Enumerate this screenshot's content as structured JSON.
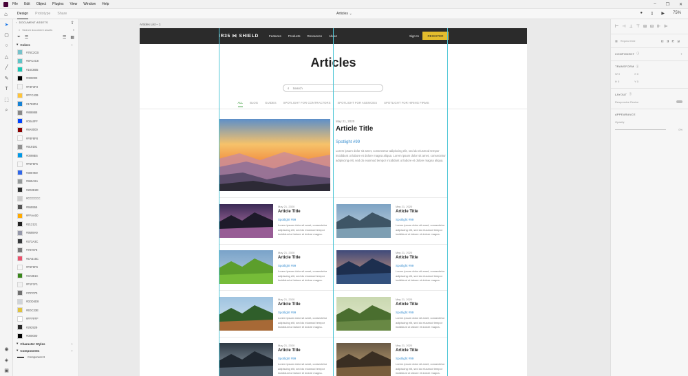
{
  "menu": [
    "File",
    "Edit",
    "Object",
    "Plugins",
    "View",
    "Window",
    "Help"
  ],
  "window_controls": [
    "–",
    "❐",
    "✕"
  ],
  "modes": [
    "Design",
    "Prototype",
    "Share"
  ],
  "doc_title": "Articles ⌄",
  "zoom": "75%",
  "assets": {
    "header": "DOCUMENT ASSETS",
    "search_placeholder": "Search document assets",
    "colors_label": "Colors",
    "colors": [
      {
        "hex": "#76C2CB"
      },
      {
        "hex": "#5FC4C8"
      },
      {
        "hex": "#16C8B5"
      },
      {
        "hex": "#000000"
      },
      {
        "hex": "#F3F3F3"
      },
      {
        "hex": "#FFC439"
      },
      {
        "hex": "#1782D4"
      },
      {
        "hex": "#888888"
      },
      {
        "hex": "#0044FF"
      },
      {
        "hex": "#8A0000"
      },
      {
        "hex": "#F8F8F8"
      },
      {
        "hex": "#919191"
      },
      {
        "hex": "#0098E6"
      },
      {
        "hex": "#F5F5F5"
      },
      {
        "hex": "#3067E9"
      },
      {
        "hex": "#969A9A"
      },
      {
        "hex": "#2D2E2E"
      },
      {
        "hex": "#CCCCCC"
      },
      {
        "hex": "#555555"
      },
      {
        "hex": "#FFAA00"
      },
      {
        "hex": "#212121"
      },
      {
        "hex": "#9598A9"
      },
      {
        "hex": "#373A3C"
      },
      {
        "hex": "#787878"
      },
      {
        "hex": "#EA516C"
      },
      {
        "hex": "#F6F6F6"
      },
      {
        "hex": "#3A861C"
      },
      {
        "hex": "#F1F1F1"
      },
      {
        "hex": "#707070"
      },
      {
        "hex": "#D0D4D8"
      },
      {
        "hex": "#E0C33E"
      },
      {
        "hex": "#FFFFFF"
      },
      {
        "hex": "#292929"
      },
      {
        "hex": "#000000"
      }
    ],
    "char_styles_label": "Character Styles",
    "components_label": "Components",
    "component_item": "Component 3"
  },
  "artboard_label": "Articles List – 1",
  "site": {
    "brand": "IR35 ⋈ SHIELD",
    "nav": [
      "Features",
      "Products",
      "Resources",
      "About"
    ],
    "signin": "Sign In",
    "register": "REGISTER",
    "heading": "Articles",
    "search_placeholder": "Search",
    "tabs": [
      "ALL",
      "BLOG",
      "GUIDES",
      "SPOTLIGHT FOR CONTRACTORS",
      "SPOTLIGHT FOR AGENCIES",
      "SPOTLIGHT FOR HIRING FIRMS"
    ],
    "featured": {
      "date": "May 21, 2020",
      "title": "Article Title",
      "spotlight": "Spotlight #99",
      "body": "Lorem ipsum dolor sit amet, consectetur adipiscing elit, sed do eiusmod tempor incididunt ut labore et dolore magna aliqua. Lorem ipsum dolor sit amet, consectetur adipiscing elit, sed do eiusmod tempor incididunt ut labore et dolore magna aliqua."
    },
    "cards": [
      {
        "date": "May 21, 2020",
        "title": "Article Title",
        "spotlight": "Spotlight #99",
        "body": "Lorem ipsum dolor sit amet, consectetur adipiscing elit, sed do eiusmod tempor incididunt ut labore et dolore magna."
      },
      {
        "date": "May 21, 2020",
        "title": "Article Title",
        "spotlight": "Spotlight #99",
        "body": "Lorem ipsum dolor sit amet, consectetur adipiscing elit, sed do eiusmod tempor incididunt ut labore et dolore magna."
      },
      {
        "date": "May 21, 2020",
        "title": "Article Title",
        "spotlight": "Spotlight #99",
        "body": "Lorem ipsum dolor sit amet, consectetur adipiscing elit, sed do eiusmod tempor incididunt ut labore et dolore magna."
      },
      {
        "date": "May 21, 2020",
        "title": "Article Title",
        "spotlight": "Spotlight #99",
        "body": "Lorem ipsum dolor sit amet, consectetur adipiscing elit, sed do eiusmod tempor incididunt ut labore et dolore magna."
      },
      {
        "date": "May 21, 2020",
        "title": "Article Title",
        "spotlight": "Spotlight #99",
        "body": "Lorem ipsum dolor sit amet, consectetur adipiscing elit, sed do eiusmod tempor incididunt ut labore et dolore magna."
      },
      {
        "date": "May 21, 2020",
        "title": "Article Title",
        "spotlight": "Spotlight #99",
        "body": "Lorem ipsum dolor sit amet, consectetur adipiscing elit, sed do eiusmod tempor incididunt ut labore et dolore magna."
      },
      {
        "date": "May 21, 2020",
        "title": "Article Title",
        "spotlight": "Spotlight #99",
        "body": "Lorem ipsum dolor sit amet, consectetur adipiscing elit, sed do eiusmod tempor incididunt ut labore et dolore magna."
      },
      {
        "date": "May 21, 2020",
        "title": "Article Title",
        "spotlight": "Spotlight #99",
        "body": "Lorem ipsum dolor sit amet, consectetur adipiscing elit, sed do eiusmod tempor incididunt ut labore et dolore magna."
      }
    ]
  },
  "right_panel": {
    "repeat_grid": "Repeat Grid",
    "component": "COMPONENT",
    "transform": "TRANSFORM",
    "w": "W  0",
    "x": "X  0",
    "h": "H  0",
    "y": "Y  0",
    "layout": "LAYOUT",
    "responsive_resize": "Responsive Resize",
    "appearance": "APPEARANCE",
    "opacity": "Opacity",
    "opacity_value": "0%"
  }
}
